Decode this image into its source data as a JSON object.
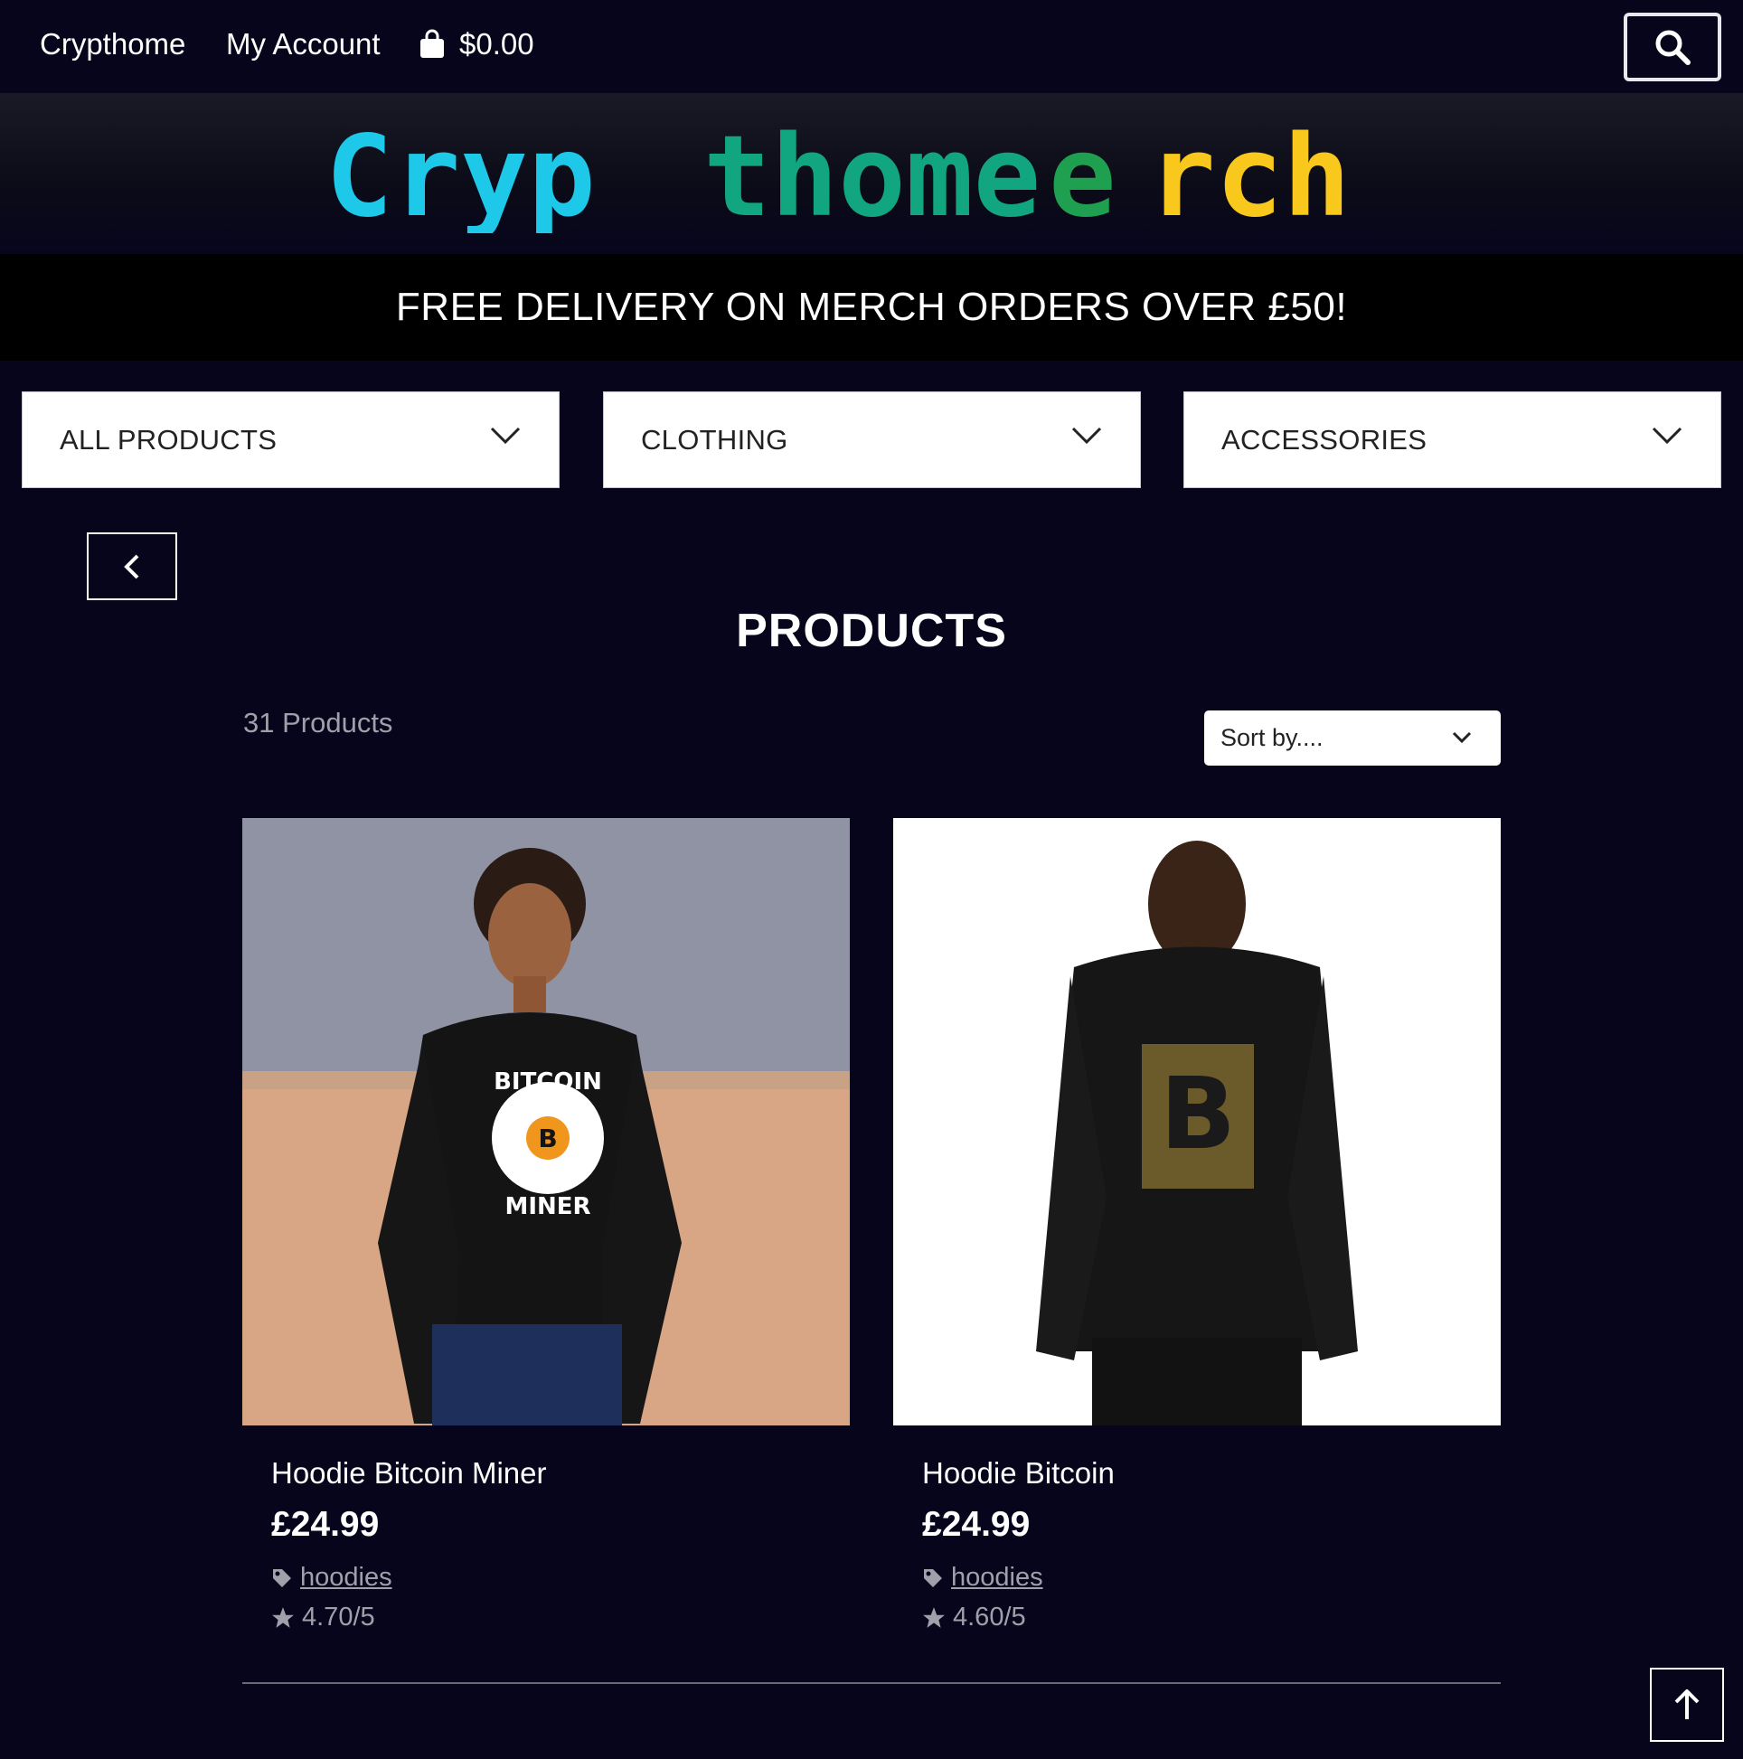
{
  "nav": {
    "home": "Crypthome",
    "account": "My Account",
    "cart_total": "$0.00"
  },
  "logo": {
    "parts": [
      {
        "text": "Cryp",
        "color": "#1ec8e8"
      },
      {
        "text": "thome",
        "color": "#12a680"
      },
      {
        "text": "rch",
        "color": "#f8c81c"
      }
    ],
    "middle": {
      "text": "e",
      "color": "#1ea050"
    }
  },
  "banner": {
    "text": "FREE DELIVERY ON MERCH ORDERS OVER £50!"
  },
  "categories": [
    {
      "label": "ALL PRODUCTS"
    },
    {
      "label": "CLOTHING"
    },
    {
      "label": "ACCESSORIES"
    }
  ],
  "page": {
    "title": "PRODUCTS",
    "count": "31 Products",
    "sort_label": "Sort by...."
  },
  "products": [
    {
      "name": "Hoodie Bitcoin Miner",
      "price": "£24.99",
      "tag": "hoodies",
      "rating": "4.70/5",
      "print_top": "BITCOIN",
      "print_bottom": "MINER"
    },
    {
      "name": "Hoodie Bitcoin",
      "price": "£24.99",
      "tag": "hoodies",
      "rating": "4.60/5"
    }
  ],
  "icons": [
    "bag-icon",
    "search-icon",
    "chevron-down-icon",
    "chevron-left-icon",
    "tag-icon",
    "star-icon",
    "arrow-up-icon"
  ]
}
